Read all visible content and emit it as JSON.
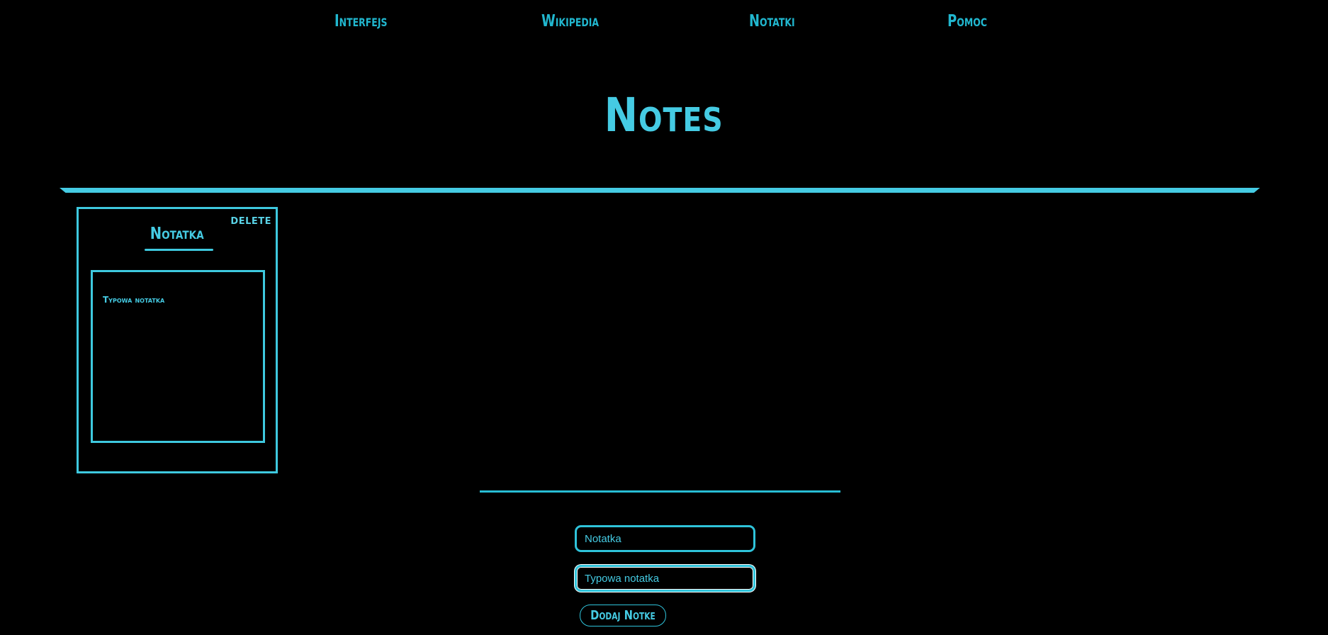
{
  "nav": {
    "items": [
      {
        "label": "Interfejs"
      },
      {
        "label": "Wikipedia"
      },
      {
        "label": "Notatki"
      },
      {
        "label": "Pomoc"
      }
    ]
  },
  "page": {
    "title": "Notes"
  },
  "notes": [
    {
      "title": "Notatka",
      "content": "Typowa notatka",
      "delete_label": "DELETE"
    }
  ],
  "form": {
    "title_placeholder": "Notatka",
    "content_placeholder": "Typowa notatka",
    "add_button_label": "Dodaj Notke"
  },
  "colors": {
    "accent": "#3ec9df",
    "background": "#000000"
  }
}
